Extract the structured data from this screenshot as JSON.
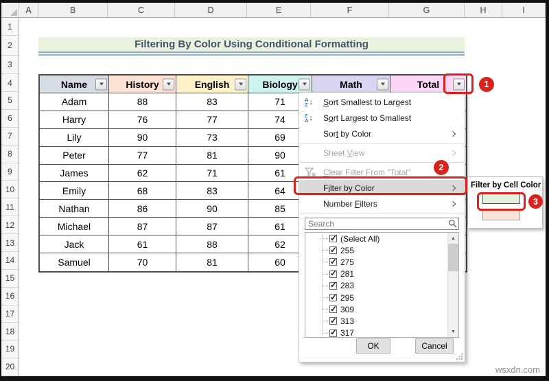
{
  "sheet": {
    "column_letters": [
      "A",
      "B",
      "C",
      "D",
      "E",
      "F",
      "G",
      "H",
      "I"
    ],
    "row_numbers": [
      "1",
      "2",
      "3",
      "4",
      "5",
      "6",
      "7",
      "8",
      "9",
      "10",
      "11",
      "12",
      "13",
      "14",
      "15",
      "16",
      "17",
      "18",
      "19",
      "20"
    ],
    "banner_title": "Filtering By Color Using Conditional Formatting"
  },
  "table": {
    "headers": [
      "Name",
      "History",
      "English",
      "Biology",
      "Math",
      "Total"
    ],
    "header_fills": [
      "#D6DCE4",
      "#FBE2D5",
      "#FFF1C9",
      "#CDF2EF",
      "#D9D4F2",
      "#FBD6F6"
    ],
    "rows": [
      [
        "Adam",
        "88",
        "83",
        "71"
      ],
      [
        "Harry",
        "76",
        "77",
        "74"
      ],
      [
        "Lily",
        "90",
        "73",
        "69"
      ],
      [
        "Peter",
        "77",
        "81",
        "90"
      ],
      [
        "James",
        "62",
        "71",
        "61"
      ],
      [
        "Emily",
        "68",
        "83",
        "64"
      ],
      [
        "Nathan",
        "86",
        "90",
        "85"
      ],
      [
        "Michael",
        "87",
        "87",
        "61"
      ],
      [
        "Jack",
        "61",
        "88",
        "62"
      ],
      [
        "Samuel",
        "70",
        "81",
        "60"
      ]
    ]
  },
  "filter_menu": {
    "items": [
      {
        "label": "Sort Smallest to Largest",
        "accel": 0,
        "icon": "sort-az-icon",
        "enabled": true,
        "submenu": false,
        "sep_after": false,
        "highlight": false
      },
      {
        "label": "Sort Largest to Smallest",
        "accel": 1,
        "icon": "sort-za-icon",
        "enabled": true,
        "submenu": false,
        "sep_after": false,
        "highlight": false
      },
      {
        "label": "Sort by Color",
        "accel": 3,
        "icon": "",
        "enabled": true,
        "submenu": true,
        "sep_after": true,
        "highlight": false
      },
      {
        "label": "Sheet View",
        "accel": 6,
        "icon": "",
        "enabled": false,
        "submenu": true,
        "sep_after": true,
        "highlight": false
      },
      {
        "label": "Clear Filter From \"Total\"",
        "accel": 0,
        "icon": "clear-filter-icon",
        "enabled": false,
        "submenu": false,
        "sep_after": false,
        "highlight": false
      },
      {
        "label": "Filter by Color",
        "accel": 1,
        "icon": "",
        "enabled": true,
        "submenu": true,
        "sep_after": false,
        "highlight": true
      },
      {
        "label": "Number Filters",
        "accel": 7,
        "icon": "",
        "enabled": true,
        "submenu": true,
        "sep_after": true,
        "highlight": false
      }
    ],
    "search_placeholder": "Search",
    "checkbox_values": [
      "(Select All)",
      "255",
      "275",
      "281",
      "283",
      "295",
      "309",
      "313",
      "317"
    ],
    "all_checked": true,
    "ok_label": "OK",
    "cancel_label": "Cancel"
  },
  "color_flyout": {
    "title": "Filter by Cell Color",
    "swatches": [
      {
        "color": "#E2EFDA",
        "name": "light-green",
        "selected": true
      },
      {
        "color": "#FCE4D6",
        "name": "light-orange",
        "selected": false
      }
    ]
  },
  "annotations": {
    "red": "#D8231F",
    "step1": "1",
    "step2": "2",
    "step3": "3"
  },
  "watermark": "wsxdn.com"
}
